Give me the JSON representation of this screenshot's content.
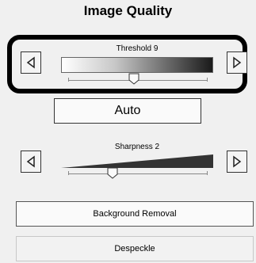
{
  "panel": {
    "title": "Image Quality"
  },
  "threshold": {
    "label": "Threshold 9",
    "value": 9,
    "slider_fraction": 0.47
  },
  "auto_button": {
    "label": "Auto"
  },
  "sharpness": {
    "label": "Sharpness 2",
    "value": 2,
    "slider_fraction": 0.32
  },
  "buttons": {
    "background_removal": "Background Removal",
    "despeckle": "Despeckle"
  },
  "icons": {
    "left": "triangle-left-icon",
    "right": "triangle-right-icon",
    "thumb": "slider-thumb-icon"
  }
}
